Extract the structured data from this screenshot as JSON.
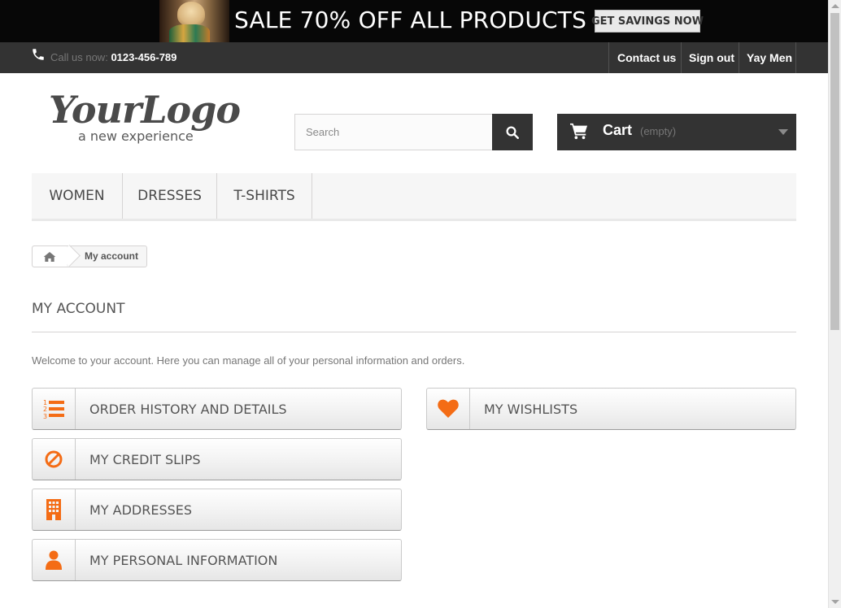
{
  "promo": {
    "text": "SALE 70% OFF ALL PRODUCTS",
    "button_label": "GET SAVINGS NOW"
  },
  "topbar": {
    "call_label": "Call us now:",
    "phone": "0123-456-789",
    "links": [
      "Contact us",
      "Sign out",
      "Yay Men"
    ]
  },
  "logo": {
    "script": "YourLogo",
    "tagline": "a new experience"
  },
  "search": {
    "placeholder": "Search",
    "value": ""
  },
  "cart": {
    "label": "Cart",
    "status": "(empty)"
  },
  "menu": {
    "items": [
      "WOMEN",
      "DRESSES",
      "T-SHIRTS"
    ]
  },
  "breadcrumb": {
    "current": "My account"
  },
  "page": {
    "title": "MY ACCOUNT",
    "welcome": "Welcome to your account. Here you can manage all of your personal information and orders."
  },
  "account_links": [
    {
      "label": "ORDER HISTORY AND DETAILS",
      "icon": "list-ol-icon"
    },
    {
      "label": "MY CREDIT SLIPS",
      "icon": "ban-icon"
    },
    {
      "label": "MY ADDRESSES",
      "icon": "building-icon"
    },
    {
      "label": "MY PERSONAL INFORMATION",
      "icon": "user-icon"
    },
    {
      "label": "MY WISHLISTS",
      "icon": "heart-icon"
    }
  ],
  "colors": {
    "accent": "#f46c15",
    "dark": "#333333",
    "promo_bg": "#070707"
  }
}
